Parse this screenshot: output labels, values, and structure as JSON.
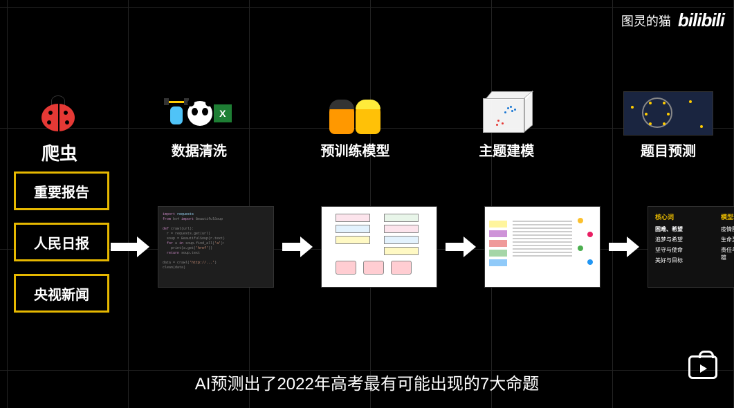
{
  "watermark": {
    "channel": "图灵的猫",
    "logo": "bilibili"
  },
  "stages": [
    {
      "label": "爬虫"
    },
    {
      "label": "数据清洗"
    },
    {
      "label": "预训练模型"
    },
    {
      "label": "主题建模"
    },
    {
      "label": "题目预测"
    }
  ],
  "sources": [
    {
      "label": "重要报告"
    },
    {
      "label": "人民日报"
    },
    {
      "label": "央视新闻"
    }
  ],
  "output_panel": {
    "col1_head": "核心词",
    "col1_sub": "困难、希望",
    "col1_items": [
      "追梦与希望",
      "坚守与使命",
      "美好与目标"
    ],
    "col2_head": "模型表征",
    "col2_items": [
      "疫情防控、长征精神",
      "生命至上、信心与忍耐",
      "责任与担当、平凡与英雄"
    ]
  },
  "subtitle": "AI预测出了2022年高考最有可能出现的7大命题"
}
